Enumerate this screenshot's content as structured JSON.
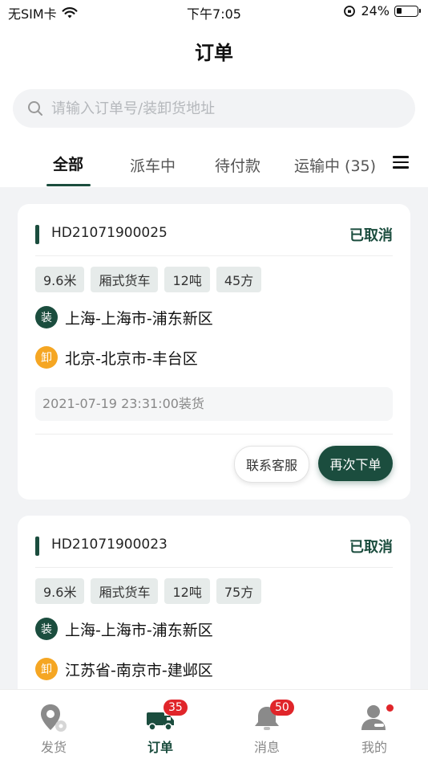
{
  "status_bar": {
    "carrier": "无SIM卡",
    "time": "下午7:05",
    "battery": "24%",
    "battery_level": 0.24
  },
  "nav": {
    "title": "订单"
  },
  "search": {
    "placeholder": "请输入订单号/装卸货地址"
  },
  "tabs": [
    {
      "label": "全部",
      "active": true
    },
    {
      "label": "派车中"
    },
    {
      "label": "待付款"
    },
    {
      "label": "运输中 (35)"
    }
  ],
  "orders": [
    {
      "order_no": "HD21071900025",
      "status": "已取消",
      "tags": [
        "9.6米",
        "厢式货车",
        "12吨",
        "45方"
      ],
      "load_marker": "装",
      "load_address": "上海-上海市-浦东新区",
      "unload_marker": "卸",
      "unload_address": "北京-北京市-丰台区",
      "time": "2021-07-19 23:31:00装货",
      "contact_label": "联系客服",
      "reorder_label": "再次下单"
    },
    {
      "order_no": "HD21071900023",
      "status": "已取消",
      "tags": [
        "9.6米",
        "厢式货车",
        "12吨",
        "75方"
      ],
      "load_marker": "装",
      "load_address": "上海-上海市-浦东新区",
      "unload_marker": "卸",
      "unload_address": "江苏省-南京市-建邺区"
    }
  ],
  "bottom_nav": [
    {
      "label": "发货",
      "icon": "location-pin-icon"
    },
    {
      "label": "订单",
      "icon": "truck-icon",
      "badge": "35",
      "active": true
    },
    {
      "label": "消息",
      "icon": "bell-icon",
      "badge": "50"
    },
    {
      "label": "我的",
      "icon": "user-icon"
    }
  ],
  "colors": {
    "brand": "#1b4d3e",
    "unload": "#f5a623",
    "badge": "#e0252a"
  }
}
